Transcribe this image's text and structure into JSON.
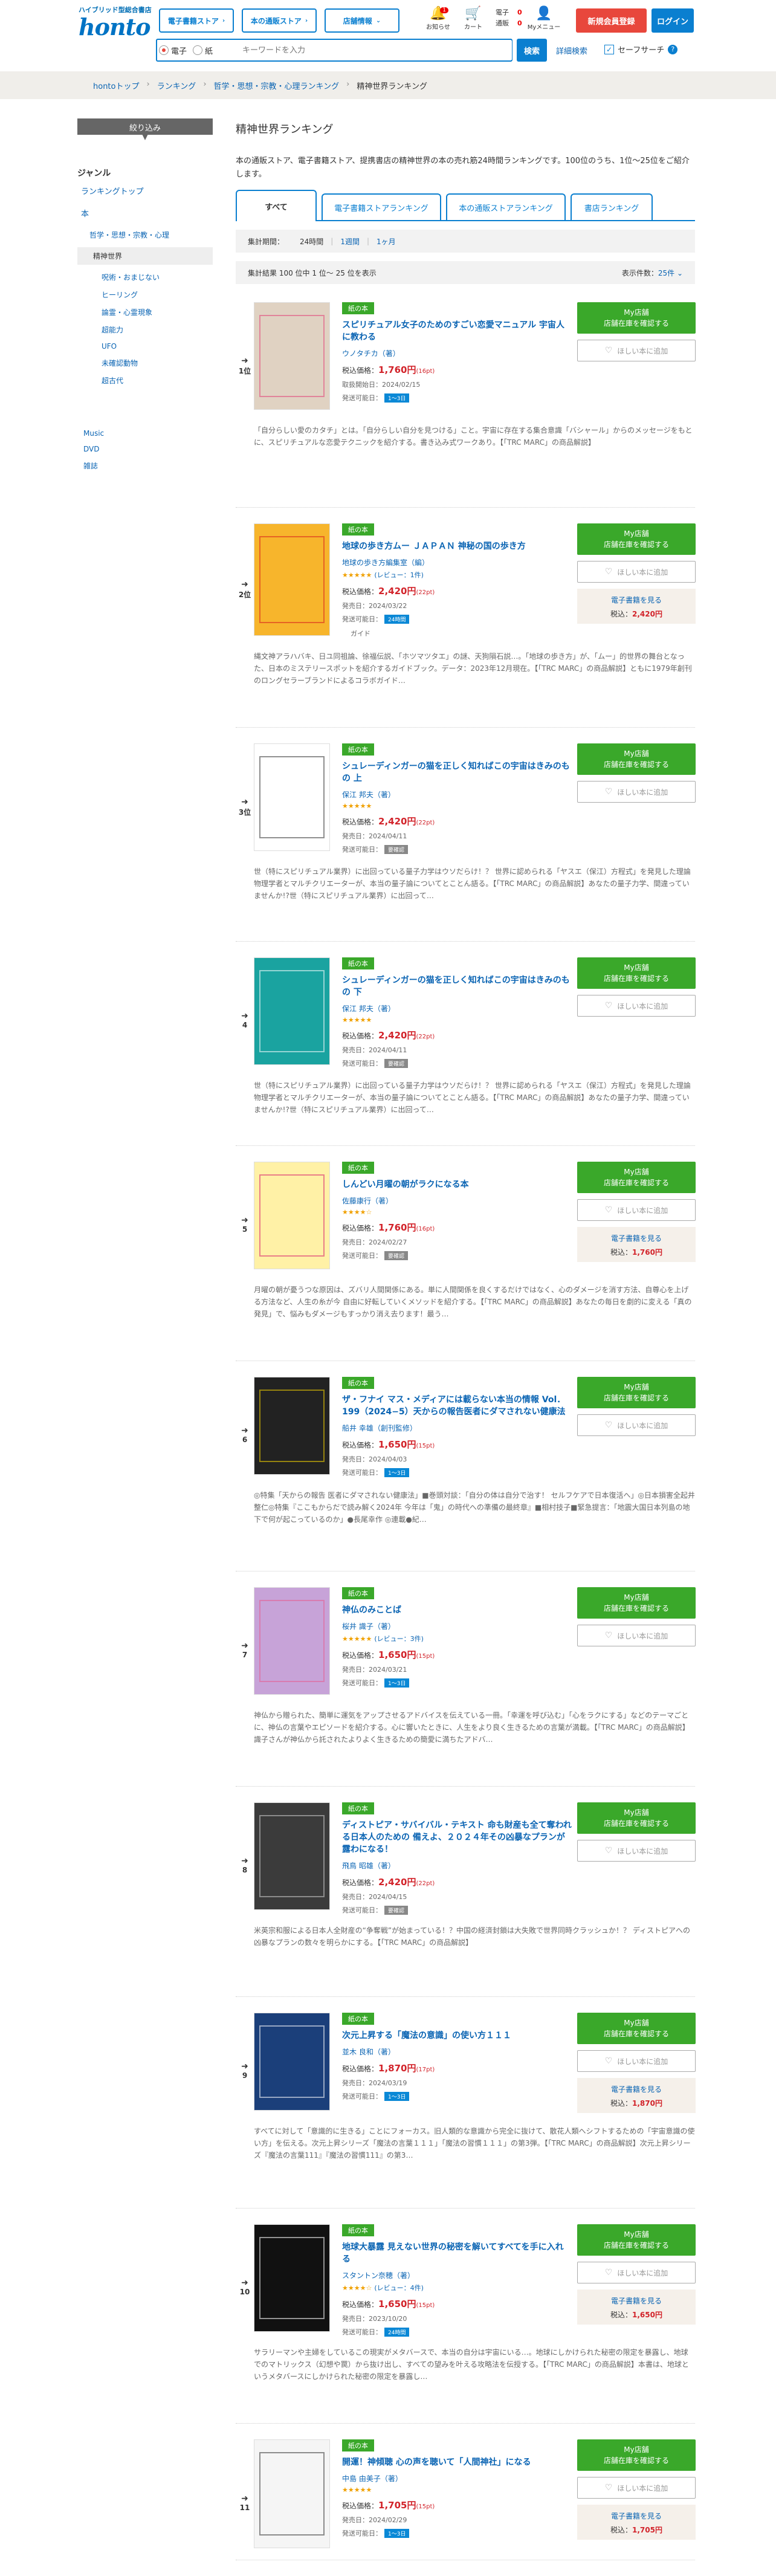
{
  "header": {
    "logo_sub": "ハイブリッド型総合書店",
    "logo": "honto",
    "nav": [
      "電子書籍ストア",
      "本の通販ストア",
      "店舗情報"
    ],
    "icons": {
      "notice": "お知らせ",
      "cart": "カート",
      "mymenu": "Myメニュー"
    },
    "notice_badge": "1",
    "cart_e": "電子",
    "cart_p": "通販",
    "cart_e_count": "0",
    "cart_p_count": "0",
    "register": "新規会員登録",
    "login": "ログイン"
  },
  "search": {
    "radio_e": "電子",
    "radio_p": "紙",
    "placeholder": "キーワードを入力",
    "button": "検索",
    "advanced": "詳細検索",
    "safe": "セーフサーチ",
    "help": "?"
  },
  "breadcrumb": [
    "hontoトップ",
    "ランキング",
    "哲学・思想・宗教・心理ランキング",
    "精神世界ランキング"
  ],
  "sidebar": {
    "narrow": "絞り込み",
    "genre_title": "ジャンル",
    "ranking_top": "ランキングトップ",
    "book": "本",
    "cat": "哲学・思想・宗教・心理",
    "current": "精神世界",
    "subs": [
      "呪術・おまじない",
      "ヒーリング",
      "論霊・心霊現象",
      "超能力",
      "UFO",
      "未確認動物",
      "超古代"
    ],
    "others": [
      "Music",
      "DVD",
      "雑誌"
    ]
  },
  "main": {
    "title": "精神世界ランキング",
    "desc": "本の通販ストア、電子書籍ストア、提携書店の精神世界の本の売れ筋24時間ランキングです。100位のうち、1位～25位をご紹介します。",
    "tabs": [
      "すべて",
      "電子書籍ストアランキング",
      "本の通販ストアランキング",
      "書店ランキング"
    ],
    "period_label": "集計期間：",
    "periods": [
      "24時間",
      "1週間",
      "1ヶ月"
    ],
    "count": "集計結果 100 位中 1 位～ 25 位を表示",
    "per_page_label": "表示件数：",
    "per_page": "25件"
  },
  "labels": {
    "tag": "紙の本",
    "price_label": "税込価格：",
    "mybtn": "My店舗\n店舗在庫を確認する",
    "wish": "ほしい本に追加",
    "ebook": "電子書籍を見る",
    "eprice_label": "税込：",
    "ship_label": "発送可能日：",
    "guide": "ガイド"
  },
  "items": [
    {
      "rank": "1位",
      "title": "スピリチュアル女子のためのすごい恋愛マニュアル 宇宙人に教わる",
      "author": "ウノタチカ（著）",
      "stars": "",
      "review": "",
      "price": "1,760円",
      "pt": "(16pt)",
      "date_label": "取扱開始日：",
      "date": "2024/02/15",
      "ship": "1～3日",
      "summary": "「自分らしい愛のカタチ」とは。「自分らしい自分を見つける」こと。宇宙に存在する集合意識「バシャール」からのメッセージをもとに、スピリチュアルな恋愛テクニックを紹介する。書き込み式ワークあり。【「TRC MARC」の商品解説】",
      "ebook": "",
      "eprice": "",
      "guide": false
    },
    {
      "rank": "2位",
      "title": "地球の歩き方ムー ＪＡＰＡＮ 神秘の国の歩き方",
      "author": "地球の歩き方編集室（編）",
      "stars": "★★★★★",
      "review": "(レビュー：1件)",
      "price": "2,420円",
      "pt": "(22pt)",
      "date_label": "発売日：",
      "date": "2024/03/22",
      "ship": "24時間",
      "summary": "縄文神アラハバキ、日ユ同祖論、徐福伝説、「ホツマツタエ」の謎、天狗隕石説…。「地球の歩き方」が、「ムー」的世界の舞台となった、日本のミステリースポットを紹介するガイドブック。データ：2023年12月現在。【「TRC MARC」の商品解説】ともに1979年創刊のロングセラーブランドによるコラボガイド…",
      "ebook": "電子書籍を見る",
      "eprice": "2,420円",
      "guide": true
    },
    {
      "rank": "3位",
      "title": "シュレーディンガーの猫を正しく知ればこの宇宙はきみのもの 上",
      "author": "保江 邦夫（著）",
      "stars": "★★★★★",
      "review": "",
      "price": "2,420円",
      "pt": "(22pt)",
      "date_label": "発売日：",
      "date": "2024/04/11",
      "ship": "要確認",
      "summary": "世（特にスピリチュアル業界）に出回っている量子力学はウソだらけ！？ 世界に認められる「ヤスエ（保江）方程式」を発見した理論物理学者とマルチクリエーターが、本当の量子論についてとことん語る。【「TRC MARC」の商品解説】あなたの量子力学、間違っていませんか!?世（特にスピリチュアル業界）に出回って…",
      "ebook": "",
      "eprice": "",
      "guide": false
    },
    {
      "rank": "4",
      "title": "シュレーディンガーの猫を正しく知ればこの宇宙はきみのもの 下",
      "author": "保江 邦夫（著）",
      "stars": "★★★★★",
      "review": "",
      "price": "2,420円",
      "pt": "(22pt)",
      "date_label": "発売日：",
      "date": "2024/04/11",
      "ship": "要確認",
      "summary": "世（特にスピリチュアル業界）に出回っている量子力学はウソだらけ！？ 世界に認められる「ヤスエ（保江）方程式」を発見した理論物理学者とマルチクリエーターが、本当の量子論についてとことん語る。【「TRC MARC」の商品解説】あなたの量子力学、間違っていませんか!?世（特にスピリチュアル業界）に出回って…",
      "ebook": "",
      "eprice": "",
      "guide": false
    },
    {
      "rank": "5",
      "title": "しんどい月曜の朝がラクになる本",
      "author": "佐藤康行（著）",
      "stars": "★★★★☆",
      "review": "",
      "price": "1,760円",
      "pt": "(16pt)",
      "date_label": "発売日：",
      "date": "2024/02/27",
      "ship": "要確認",
      "summary": "月曜の朝が憂うつな原因は、ズバリ人間関係にある。単に人間関係を良くするだけではなく、心のダメージを消す方法、自尊心を上げる方法など、人生の糸が今 自由に好転していくメソッドを紹介する。【「TRC MARC」の商品解説】あなたの毎日を劇的に変える「真の発見」で、悩みもダメージもすっかり消え去ります！最う…",
      "ebook": "電子書籍を見る",
      "eprice": "1,760円",
      "guide": false
    },
    {
      "rank": "6",
      "title": "ザ・フナイ マス・メディアには載らない本当の情報 Vol．199（2024−5）天からの報告医者にダマされない健康法",
      "author": "船井 幸雄（創刊監修）",
      "stars": "",
      "review": "",
      "price": "1,650円",
      "pt": "(15pt)",
      "date_label": "発売日：",
      "date": "2024/04/03",
      "ship": "1～3日",
      "summary": "◎特集「天からの報告 医者にダマされない健康法」■巻頭対談：「自分の体は自分で治す！ セルフケアで日本復活へ」◎日本損害全起井整仁◎特集『ここもからだで読み解く2024年 今年は「鬼」の時代への準備の最終章』■相村技子■緊急提言：「地震大国日本列島の地下で何が起こっているのか」●長尾幸作 ◎連載●紀…",
      "ebook": "",
      "eprice": "",
      "guide": false
    },
    {
      "rank": "7",
      "title": "神仏のみことば",
      "author": "桜井 識子（著）",
      "stars": "★★★★★",
      "review": "(レビュー：3件)",
      "price": "1,650円",
      "pt": "(15pt)",
      "date_label": "発売日：",
      "date": "2024/03/21",
      "ship": "1～3日",
      "summary": "神仏から贈られた、簡単に運気をアップさせるアドバイスを伝えている一冊。「幸運を呼び込む」「心をラクにする」などのテーマごとに、神仏の言葉やエピソードを紹介する。心に響いたときに、人生をより良く生きるための言葉が満載。【「TRC MARC」の商品解説】識子さんが神仏から託されたよりよく生きるための簡愛に満ちたアドバ…",
      "ebook": "",
      "eprice": "",
      "guide": false
    },
    {
      "rank": "8",
      "title": "ディストピア・サバイバル・テキスト 命も財産も全て奪われる日本人のための 備えよ、２０２４年その凶暴なプランが露わになる！",
      "author": "飛鳥 昭雄（著）",
      "stars": "",
      "review": "",
      "price": "2,420円",
      "pt": "(22pt)",
      "date_label": "発売日：",
      "date": "2024/04/15",
      "ship": "要確認",
      "summary": "米英宗和服による日本人全財産の“争奪戦”が始まっている！？中国の経済封鎖は大失敗で世界同時クラッシュか！？ ディストピアへの凶暴なプランの数々を明らかにする。【「TRC MARC」の商品解説】",
      "ebook": "",
      "eprice": "",
      "guide": false
    },
    {
      "rank": "9",
      "title": "次元上昇する「魔法の意識」の使い方１１１",
      "author": "並木 良和（著）",
      "stars": "",
      "review": "",
      "price": "1,870円",
      "pt": "(17pt)",
      "date_label": "発売日：",
      "date": "2024/03/19",
      "ship": "1～3日",
      "summary": "すべてに対して「意識的に生きる」ことにフォーカス。旧人類的な意識から完全に抜けて、散花人類へシフトするための「宇宙意識の使い方」を伝える。次元上昇シリーズ「魔法の言葉１１１」「魔法の習慣１１１」の第3弾。【「TRC MARC」の商品解説】次元上昇シリーズ『魔法の言葉111』『魔法の習慣111』の第3…",
      "ebook": "電子書籍を見る",
      "eprice": "1,870円",
      "guide": false
    },
    {
      "rank": "10",
      "title": "地球大暴露 見えない世界の秘密を解いてすべてを手に入れる",
      "author": "スタントン奈穂（著）",
      "stars": "★★★★☆",
      "review": "(レビュー：4件)",
      "price": "1,650円",
      "pt": "(15pt)",
      "date_label": "発売日：",
      "date": "2023/10/20",
      "ship": "24時間",
      "summary": "サラリーマンや主婦をしているこの現実がメタバースで、本当の自分は宇宙にいる…。地球にしかけられた秘密の限定を暴露し、地球でのマトリックス（幻想や罠）から抜け出し、すべての望みを叶える攻略法を伝授する。【「TRC MARC」の商品解説】本書は、地球というメタバースにしかけられた秘密の限定を暴露し…",
      "ebook": "電子書籍を見る",
      "eprice": "1,650円",
      "guide": false
    },
    {
      "rank": "11",
      "title": "開運！神傾聴 心の声を聴いて「人間神社」になる",
      "author": "中島 由美子（著）",
      "stars": "★★★★★",
      "review": "",
      "price": "1,705円",
      "pt": "(15pt)",
      "date_label": "発売日：",
      "date": "2024/02/29",
      "ship": "1～3日",
      "summary": "",
      "ebook": "電子書籍を見る",
      "eprice": "1,705円",
      "guide": false
    }
  ],
  "colors": {
    "brand": "#0a7fd0",
    "green": "#3aa82a",
    "red": "#d2232a"
  }
}
